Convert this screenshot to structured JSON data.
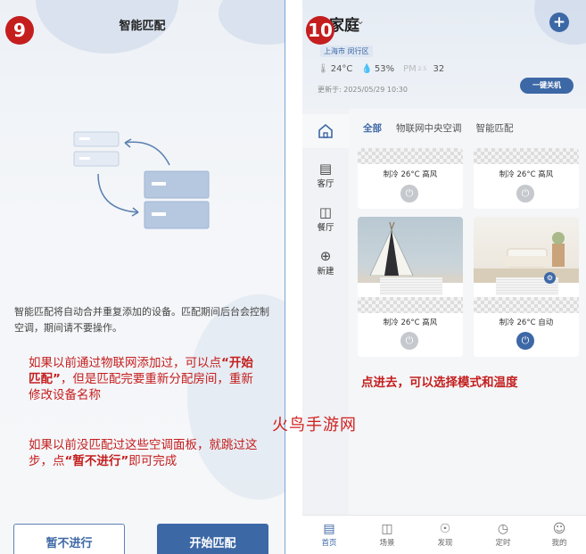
{
  "left": {
    "step": "9",
    "title": "智能匹配",
    "description": "智能匹配将自动合并重复添加的设备。匹配期间后台会控制空调，期间请不要操作。",
    "note1_a": "如果以前通过物联网添加过，可以点",
    "note1_bold": "“开始匹配”",
    "note1_b": "，但是匹配完要重新分配房间，重新修改设备名称",
    "note2_a": "如果以前没匹配过这些空调面板，就跳过这步，点",
    "note2_bold": "“暂不进行”",
    "note2_b": "即可完成",
    "skip_label": "暂不进行",
    "start_label": "开始匹配"
  },
  "right": {
    "step": "10",
    "home_name": "家庭",
    "location": "上海市 闵行区",
    "temperature": "24°C",
    "humidity": "53%",
    "pm_label": "PM",
    "pm_sub": "2.5",
    "pm_value": "32",
    "updated": "更新于: 2025/05/29 10:30",
    "power_off_label": "一键关机",
    "tabs": [
      "全部",
      "物联网中央空调",
      "智能匹配"
    ],
    "rooms": [
      "客厅",
      "餐厅",
      "新建"
    ],
    "cards": [
      {
        "status": "制冷 26°C 高风",
        "on": false
      },
      {
        "status": "制冷 26°C 高风",
        "on": false
      },
      {
        "status": "制冷 26°C 高风",
        "on": false
      },
      {
        "status": "制冷 26°C 自动",
        "on": true
      }
    ],
    "note": "点进去，可以选择模式和温度",
    "bottom_nav": [
      "首页",
      "场景",
      "发现",
      "定时",
      "我的"
    ]
  },
  "watermark": "火鸟手游网",
  "colors": {
    "accent": "#3d68a6",
    "red": "#c41e1e"
  }
}
